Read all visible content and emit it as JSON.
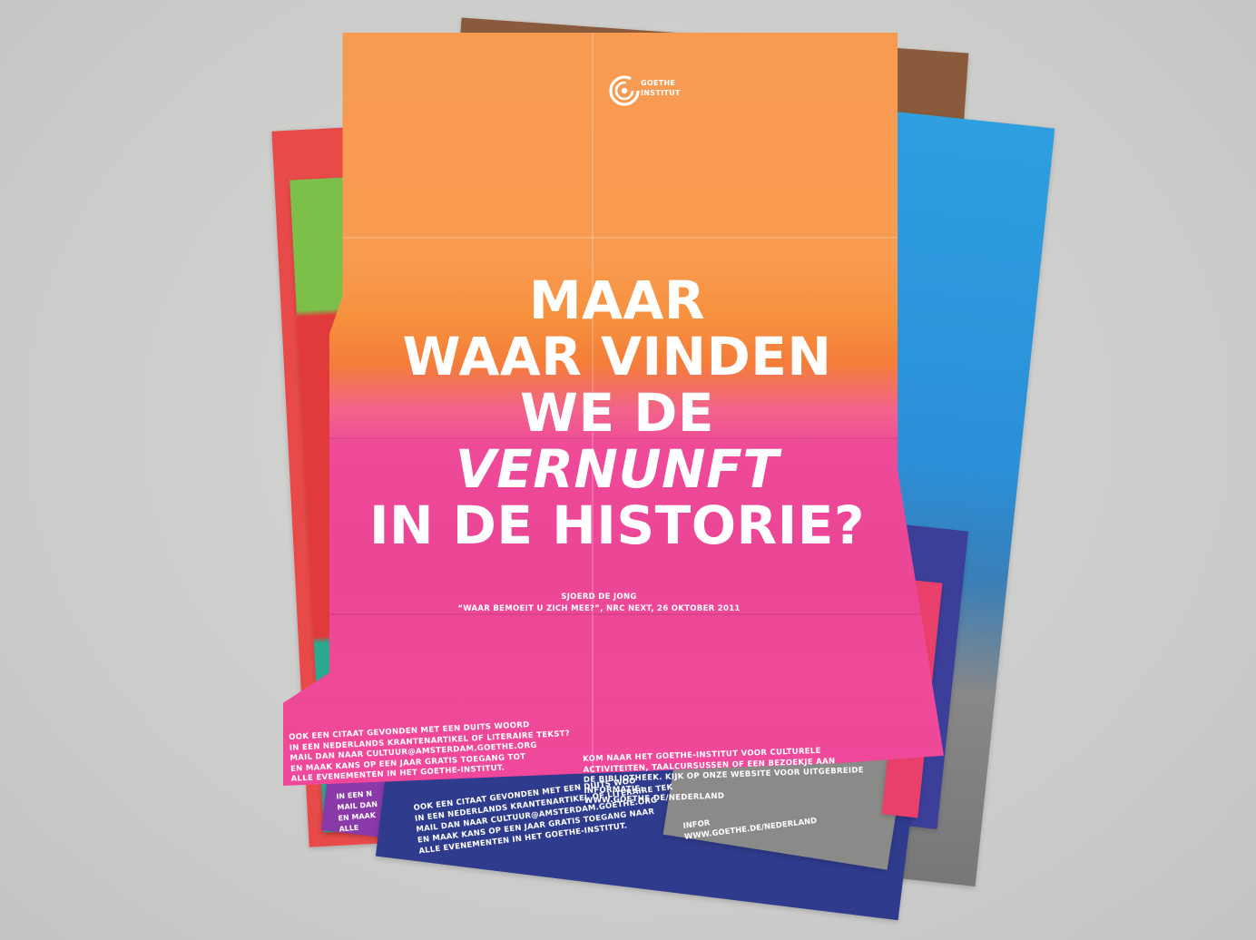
{
  "scene": {
    "background_color": "#cfcfcd"
  },
  "poster": {
    "colors": {
      "top": "#f89b52",
      "bottom": "#ec4696",
      "text": "#ffffff"
    },
    "logo": {
      "icon": "goethe-circle-logo-icon",
      "line1": "GOETHE",
      "line2": "INSTITUT"
    },
    "headline": [
      "MAAR",
      "WAAR VINDEN",
      "WE DE",
      "VERNUNFT",
      "IN DE HISTORIE?"
    ],
    "attribution": {
      "author": "SJOERD DE JONG",
      "source": "“WAAR BEMOEIT U ZICH MEE?”, NRC NEXT, 26 OKTOBER 2011"
    },
    "footer_left": [
      "OOK EEN CITAAT GEVONDEN MET EEN DUITS WOORD",
      "IN EEN NEDERLANDS KRANTENARTIKEL OF LITERAIRE TEKST?",
      "MAIL DAN NAAR CULTUUR@AMSTERDAM.GOETHE.ORG",
      "EN MAAK KANS OP EEN JAAR GRATIS TOEGANG TOT",
      "ALLE EVENEMENTEN IN HET GOETHE-INSTITUT."
    ],
    "footer_right": [
      "KOM NAAR HET GOETHE-INSTITUT VOOR CULTURELE",
      "ACTIVITEITEN, TAALCURSUSSEN OF EEN BEZOEKJE AAN",
      "DE BIBLIOTHEEK. KIJK OP ONZE WEBSITE VOOR UITGEBREIDE",
      "INFORMATIE:",
      "WWW.GOETHE.DE/NEDERLAND"
    ]
  },
  "back_posters": {
    "navy_footer": [
      "OOK EEN CITAAT GEVONDEN MET EEN DUITS WOO",
      "IN EEN NEDERLANDS KRANTENARTIKEL OF LITERAIRE TEK",
      "MAIL DAN NAAR CULTUUR@AMSTERDAM.GOETHE.ORG",
      "EN MAAK KANS OP EEN JAAR GRATIS TOEGANG NAAR",
      "ALLE EVENEMENTEN IN HET GOETHE-INSTITUT."
    ],
    "navy_right": [
      "INFOR",
      "WWW.GOETHE.DE/NEDERLAND"
    ],
    "purple_left": [
      "IN EEN N",
      "MAIL DAN",
      "EN MAAK",
      "ALLE"
    ],
    "colors": [
      "#8a5a3c",
      "#2f9fe0",
      "#e84a4a",
      "#7cc04a",
      "#8a3aa8",
      "#2f3b8c"
    ]
  }
}
